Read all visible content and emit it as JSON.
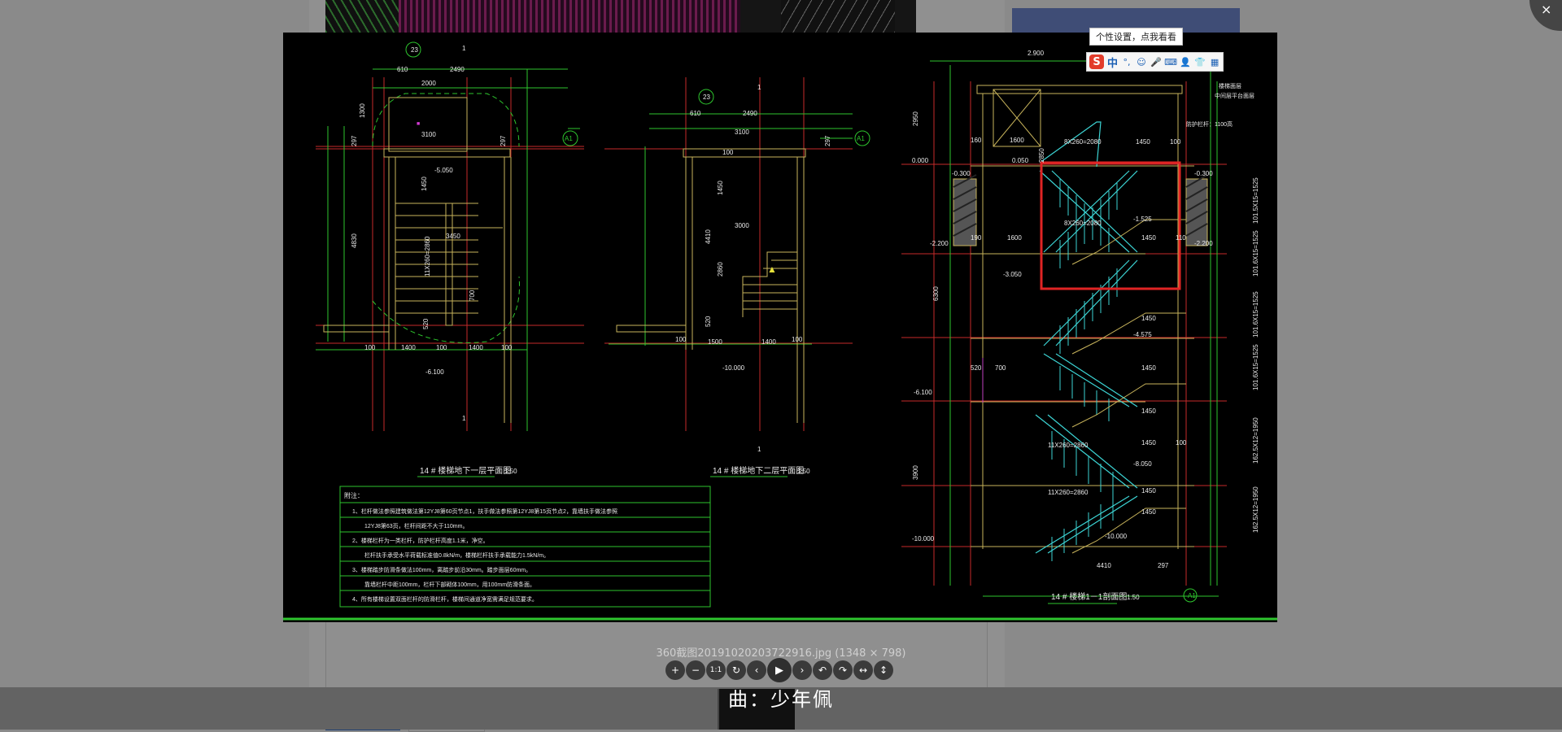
{
  "viewer": {
    "caption": "360截图20191020203722916.jpg (1348 × 798)",
    "close_icon": "×",
    "toolbar": [
      {
        "name": "zoom-in-button",
        "icon": "+"
      },
      {
        "name": "zoom-out-button",
        "icon": "−"
      },
      {
        "name": "actual-size-button",
        "icon": "1:1"
      },
      {
        "name": "reset-button",
        "icon": "↻"
      },
      {
        "name": "previous-button",
        "icon": "‹"
      },
      {
        "name": "play-button",
        "icon": "▶"
      },
      {
        "name": "next-button",
        "icon": "›"
      },
      {
        "name": "rotate-left-button",
        "icon": "↶"
      },
      {
        "name": "rotate-right-button",
        "icon": "↷"
      },
      {
        "name": "flip-horizontal-button",
        "icon": "↔"
      },
      {
        "name": "flip-vertical-button",
        "icon": "↕"
      }
    ]
  },
  "music": {
    "text": "曲：少年佩"
  },
  "ime": {
    "tip": "个性设置，点我看看",
    "logo": "S",
    "mode": "中",
    "icons": [
      "punctuation-icon",
      "emoji-icon",
      "microphone-icon",
      "keyboard-icon",
      "user-icon",
      "skin-icon",
      "toolbox-icon"
    ],
    "glyphs": [
      "°,",
      "☺",
      "🎤",
      "⌨",
      "👤",
      "👕",
      "▦"
    ]
  },
  "drawing": {
    "grid_labels": [
      "23",
      "1",
      "23",
      "1",
      "A1",
      "A1",
      "A1",
      "1",
      "1"
    ],
    "plan1_title": "14 # 楼梯地下一层平面图",
    "plan2_title": "14 # 楼梯地下二层平面图",
    "section_title": "14 # 楼梯1－1剖面图",
    "scale": "1:50",
    "dims_plan1": [
      "610",
      "2490",
      "2000",
      "3100",
      "1300",
      "297",
      "297",
      "4830",
      "11X260=2860",
      "1450",
      "520",
      "100",
      "1400",
      "100",
      "1400",
      "100",
      "700"
    ],
    "elev_plan1": [
      "-5.050",
      "-6.100",
      "3450"
    ],
    "dims_plan2": [
      "610",
      "2490",
      "3100",
      "100",
      "1450",
      "4410",
      "3000",
      "2860",
      "520",
      "100",
      "1500",
      "1400",
      "100",
      "297"
    ],
    "elev_plan2": [
      "-10.000"
    ],
    "dims_section": [
      "2.900",
      "2950",
      "160",
      "1600",
      "2850",
      "0.000",
      "-0.300",
      "-0.300",
      "0.050",
      "-2.200",
      "-2.200",
      "190",
      "1600",
      "-3.050",
      "6300",
      "8X260=2080",
      "1450",
      "100",
      "-1.525",
      "1450",
      "110",
      "1450",
      "-4.575",
      "1450",
      "520",
      "700",
      "1450",
      "-6.100",
      "1450",
      "100",
      "11X260=2860",
      "1450",
      "-8.050",
      "1450",
      "3900",
      "-10.000",
      "11X260=2860",
      "4410",
      "297",
      "-10.000",
      "8X260=2080"
    ],
    "right_dims": [
      "101.5X15=1525",
      "101.6X15=1525",
      "101.6X15=1525",
      "101.6X15=1525",
      "162.5X12=1950",
      "162.5X12=1950"
    ],
    "notes_title": "附注：",
    "notes": [
      "1、栏杆做法参照建筑做法第12YJ8第60页节点1，扶手做法参照第12YJ8第15页节点2，靠墙扶手做法参照",
      "12YJ8第63页，栏杆间距不大于110mm。",
      "2、楼梯栏杆为一类栏杆，防护栏杆高度1.1米，净空。",
      "栏杆扶手承受水平荷载标准值0.8kN/m，楼梯栏杆扶手承载能力1.5kN/m。",
      "3、楼梯踏步防滑条做法100mm，离踏步前沿30mm。踏步面层60mm。",
      "靠墙栏杆中距100mm，栏杆下部砌体100mm，用100mm防滑条面。",
      "4、所有楼梯设置双面栏杆的防滑栏杆，楼梯间通道净宽需满足规范要求。"
    ],
    "legend_items": [
      "楼梯面层",
      "中间层平台面层"
    ],
    "guard_note": "防护栏杆：1100高"
  }
}
